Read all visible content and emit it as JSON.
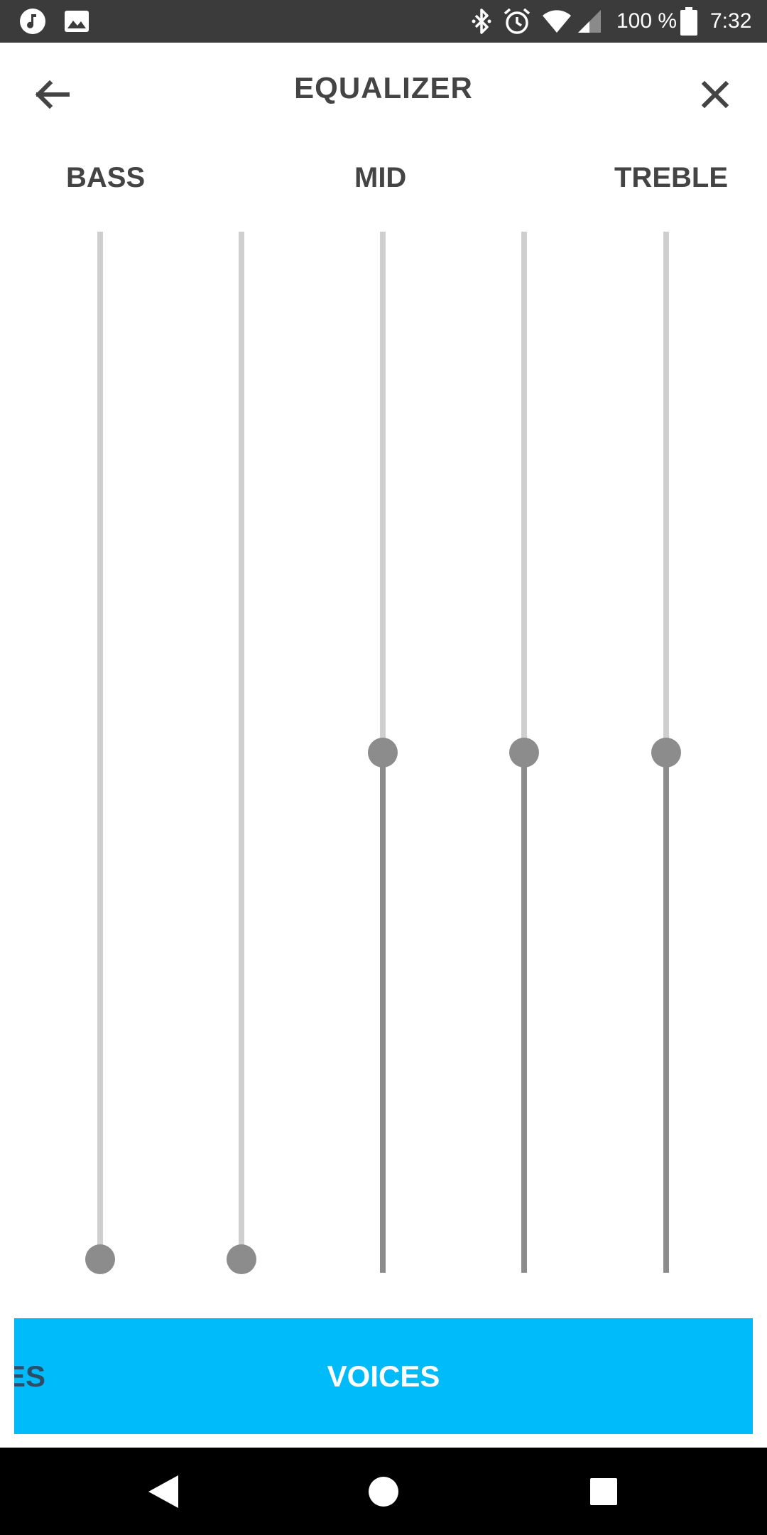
{
  "status_bar": {
    "time": "7:32",
    "battery": "100 %",
    "left_icons": [
      "music-note-icon",
      "image-icon"
    ],
    "right_icons": [
      "bluetooth-icon",
      "alarm-icon",
      "wifi-icon",
      "signal-icon",
      "battery-icon"
    ]
  },
  "header": {
    "title": "EQUALIZER",
    "back_icon": "arrow-left-icon",
    "close_icon": "close-icon"
  },
  "bands": {
    "bass": "BASS",
    "mid": "MID",
    "treble": "TREBLE"
  },
  "sliders": [
    {
      "level": 0.0
    },
    {
      "level": 0.0
    },
    {
      "level": 0.5
    },
    {
      "level": 0.5
    },
    {
      "level": 0.5
    }
  ],
  "presets": {
    "previous_partial": "ES",
    "current": "VOICES"
  },
  "nav_bar": {
    "icons": [
      "back-triangle-icon",
      "home-circle-icon",
      "recents-square-icon"
    ]
  },
  "colors": {
    "status_bar": "#3b3b3b",
    "accent": "#00bbf9",
    "text_dark": "#444444",
    "track": "#cfcfcf",
    "thumb": "#8c8c8c",
    "nav_bar": "#000000"
  }
}
